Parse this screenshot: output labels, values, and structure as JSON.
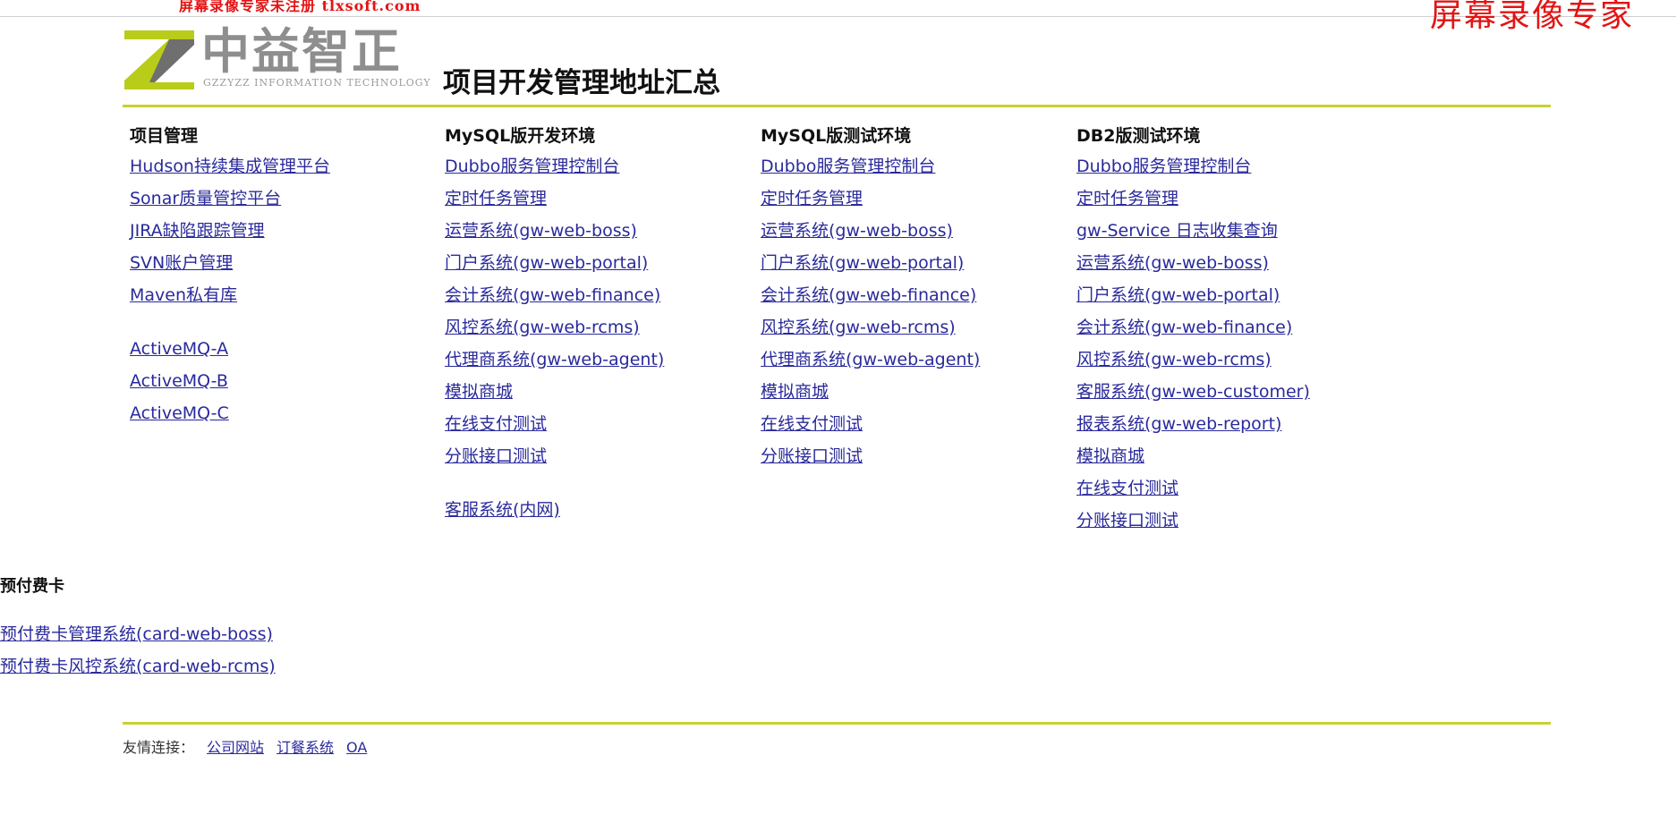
{
  "watermark": {
    "left_text": "屏幕录像专家未注册 tlxsoft.com",
    "right_text": "屏幕录像专家"
  },
  "header": {
    "logo_cn": "中益智正",
    "logo_en": "GZZYZZ INFORMATION TECHNOLOGY",
    "title": "项目开发管理地址汇总"
  },
  "columns": [
    {
      "heading": "项目管理",
      "links": [
        "Hudson持续集成管理平台",
        "Sonar质量管控平台",
        "JIRA缺陷跟踪管理",
        "SVN账户管理",
        "Maven私有库"
      ],
      "links2": [
        "ActiveMQ-A",
        "ActiveMQ-B",
        "ActiveMQ-C"
      ]
    },
    {
      "heading": "MySQL版开发环境",
      "links": [
        "Dubbo服务管理控制台",
        "定时任务管理",
        "运营系统(gw-web-boss)",
        "门户系统(gw-web-portal)",
        "会计系统(gw-web-finance)",
        "风控系统(gw-web-rcms)",
        "代理商系统(gw-web-agent)",
        "模拟商城",
        "在线支付测试",
        "分账接口测试"
      ],
      "links2": [
        "客服系统(内网)"
      ]
    },
    {
      "heading": "MySQL版测试环境",
      "links": [
        "Dubbo服务管理控制台",
        "定时任务管理",
        "运营系统(gw-web-boss)",
        "门户系统(gw-web-portal)",
        "会计系统(gw-web-finance)",
        "风控系统(gw-web-rcms)",
        "代理商系统(gw-web-agent)",
        "模拟商城",
        "在线支付测试",
        "分账接口测试"
      ]
    },
    {
      "heading": "DB2版测试环境",
      "links": [
        "Dubbo服务管理控制台",
        "定时任务管理",
        "gw-Service 日志收集查询",
        "运营系统(gw-web-boss)",
        "门户系统(gw-web-portal)",
        "会计系统(gw-web-finance)",
        "风控系统(gw-web-rcms)",
        "客服系统(gw-web-customer)",
        "报表系统(gw-web-report)",
        "模拟商城",
        "在线支付测试",
        "分账接口测试"
      ]
    }
  ],
  "prepaid": {
    "heading": "预付费卡",
    "links": [
      "预付费卡管理系统(card-web-boss)",
      "预付费卡风控系统(card-web-rcms)"
    ]
  },
  "footer": {
    "label": "友情连接：",
    "links": [
      "公司网站",
      "订餐系统",
      "OA"
    ]
  },
  "colors": {
    "rule": "#c8d12f",
    "link": "#2a2a9c",
    "logo_green": "#b9cc1a",
    "logo_gray": "#8e8e8e",
    "watermark": "#e31414"
  }
}
